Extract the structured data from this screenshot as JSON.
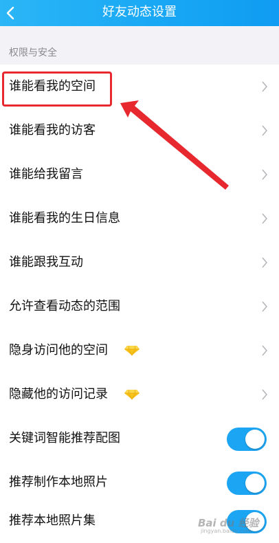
{
  "header": {
    "title": "好友动态设置",
    "back_icon": "chevron-left-icon"
  },
  "section": {
    "label": "权限与安全"
  },
  "items": [
    {
      "label": "谁能看我的空间",
      "type": "nav"
    },
    {
      "label": "谁能看我的访客",
      "type": "nav"
    },
    {
      "label": "谁能给我留言",
      "type": "nav"
    },
    {
      "label": "谁能看我的生日信息",
      "type": "nav"
    },
    {
      "label": "谁能跟我互动",
      "type": "nav"
    },
    {
      "label": "允许查看动态的范围",
      "type": "nav"
    },
    {
      "label": "隐身访问他的空间",
      "type": "nav",
      "badge": "diamond-icon"
    },
    {
      "label": "隐藏他的访问记录",
      "type": "nav",
      "badge": "diamond-icon"
    },
    {
      "label": "关键词智能推荐配图",
      "type": "toggle",
      "on": true
    },
    {
      "label": "推荐制作本地照片",
      "type": "toggle",
      "on": true
    },
    {
      "label": "推荐本地照片集",
      "type": "toggle",
      "on": true
    }
  ],
  "annotation": {
    "highlight_color": "#e8282f",
    "highlighted_item": "谁能看我的空间"
  },
  "watermark": {
    "text": "Bai du 经验",
    "subtext": "jingyan.baidu.com"
  },
  "colors": {
    "header_gradient_start": "#2bb6f6",
    "header_gradient_end": "#0f9cf2",
    "toggle_on": "#1ca5f3",
    "section_bg": "#f2f2f7",
    "diamond": "#f7c21a"
  }
}
